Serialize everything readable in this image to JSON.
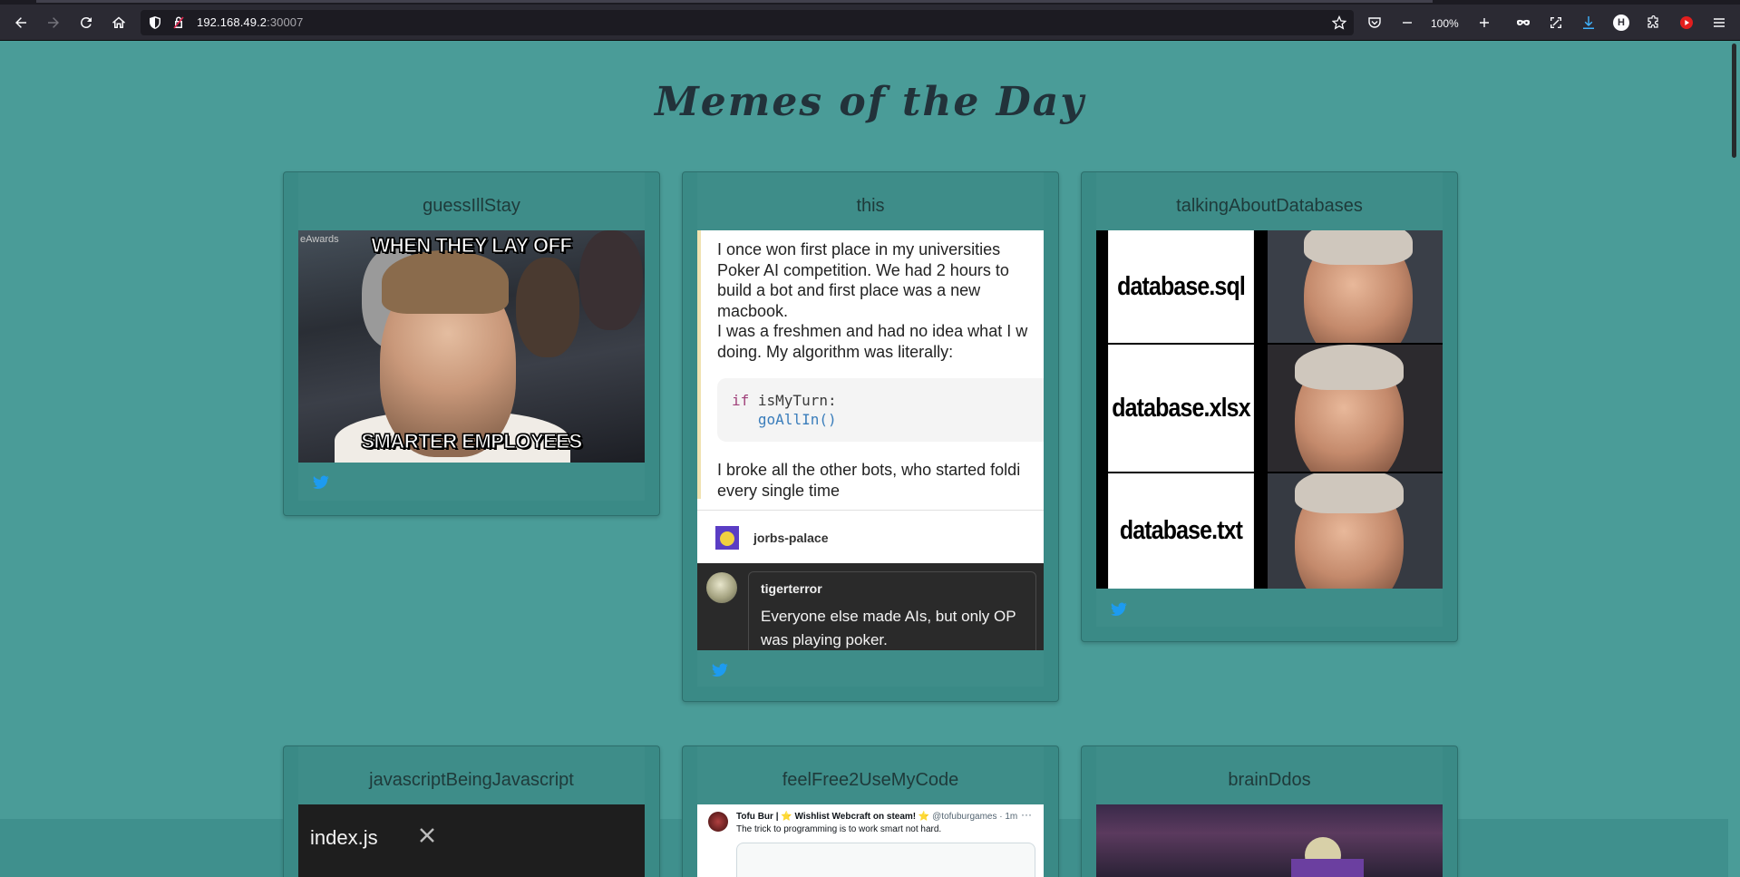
{
  "browser": {
    "url_host": "192.168.49.2",
    "url_port": ":30007",
    "zoom": "100%",
    "profile_initial": "H",
    "icons": [
      "back-icon",
      "forward-icon",
      "reload-icon",
      "home-icon",
      "shield-icon",
      "lock-icon",
      "bookmark-star-icon",
      "pocket-icon",
      "zoom-out-icon",
      "zoom-in-icon",
      "private-mask-icon",
      "screenshot-icon",
      "download-icon",
      "profile-icon",
      "extensions-icon",
      "youtube-icon",
      "menu-icon"
    ]
  },
  "page": {
    "title": "Memes of the Day"
  },
  "memes": [
    {
      "title": "guessIllStay",
      "caption_top": "WHEN THEY LAY OFF",
      "caption_bottom": "SMARTER EMPLOYEES",
      "watermark": "eAwards"
    },
    {
      "title": "this",
      "post_lines": [
        "I once won first place in my universities",
        "Poker AI competition. We had 2 hours to",
        "build a bot and first place was a new",
        "macbook.",
        "I was a freshmen and had no idea what I w",
        "doing. My algorithm was literally:"
      ],
      "code_keyword": "if",
      "code_condition": " isMyTurn:",
      "code_call": "goAllIn()",
      "post_after_lines": [
        "I broke all the other bots, who started foldi",
        "every single time"
      ],
      "author": "jorbs-palace",
      "reply_author": "tigerterror",
      "reply_text": "Everyone else made AIs, but only OP was playing poker."
    },
    {
      "title": "talkingAboutDatabases",
      "rows": [
        "database.sql",
        "database.xlsx",
        "database.txt"
      ]
    },
    {
      "title": "javascriptBeingJavascript",
      "tab_name": "index.js"
    },
    {
      "title": "feelFree2UseMyCode",
      "tweet_name": "Tofu Bur | ⭐ Wishlist Webcraft on steam! ⭐",
      "tweet_handle": "@tofuburgames · 1m",
      "tweet_text": "The trick to programming is to work smart not hard.",
      "tweet_more": "···"
    },
    {
      "title": "brainDdos"
    }
  ],
  "colors": {
    "page_bg": "#4a9c98",
    "card_bg": "#3a8a86",
    "twitter_blue": "#1d9bf0",
    "browser_toolbar": "#2b2a33"
  }
}
